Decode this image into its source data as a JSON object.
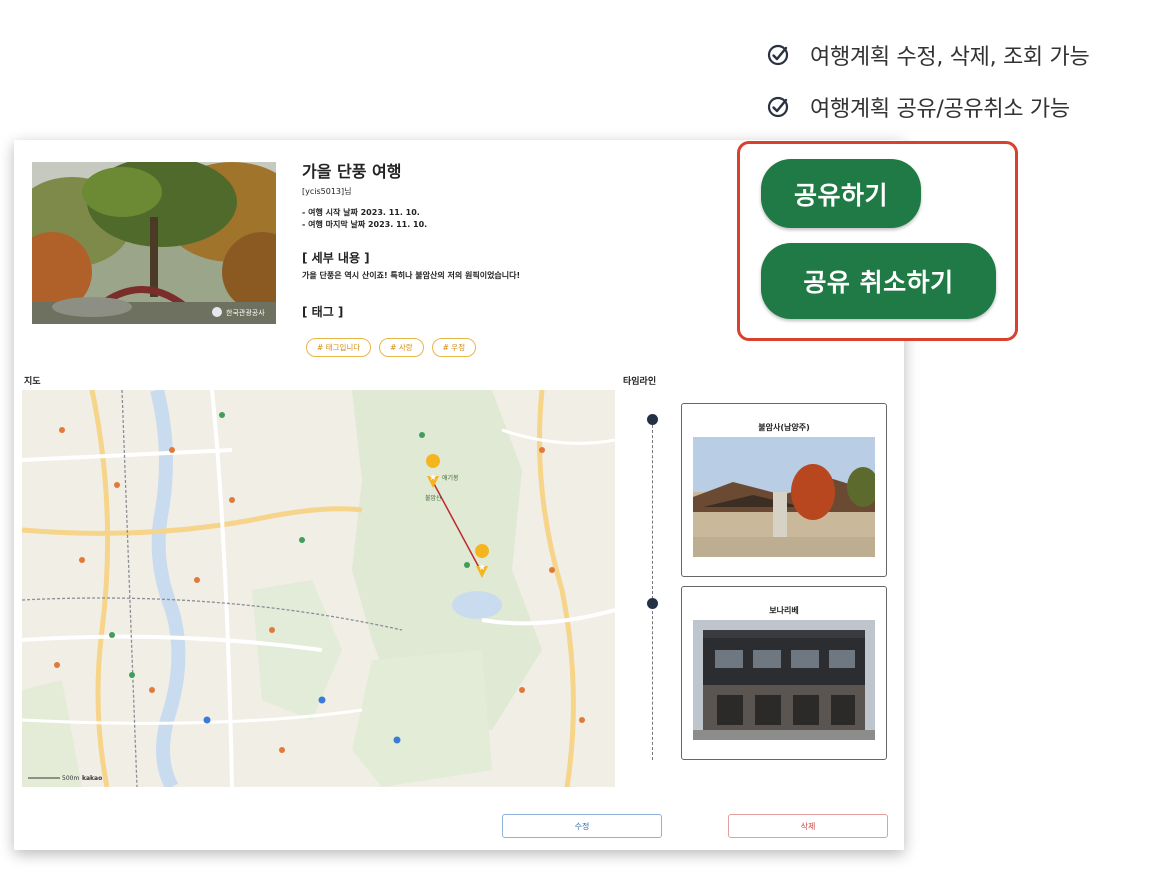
{
  "features": [
    {
      "icon": "check-circle-icon",
      "label": "여행계획 수정, 삭제, 조회 가능"
    },
    {
      "icon": "check-circle-icon",
      "label": "여행계획 공유/공유취소 가능"
    }
  ],
  "plan": {
    "title": "가을 단풍 여행",
    "user": "[ycis5013]님",
    "start_date": "- 여행 시작 날짜 2023. 11. 10.",
    "end_date": "- 여행 마지막 날짜 2023. 11. 10.",
    "detail_heading": "[ 세부 내용 ]",
    "detail_text": "가을 단풍은 역시 산이죠! 특히나 불암산의 저의 원픽이었습니다!",
    "tag_heading": "[ 태그 ]",
    "tags": [
      "# 태그입니다",
      "# 사랑",
      "# 우정"
    ],
    "photo_watermark": "한국관광공사"
  },
  "map": {
    "label": "지도",
    "markers": [
      "애기봉",
      "불암산"
    ],
    "scale_text": "500m",
    "provider": "kakao"
  },
  "timeline": {
    "label": "타임라인",
    "items": [
      {
        "name": "불암사(남양주)"
      },
      {
        "name": "보나리베"
      }
    ]
  },
  "actions": {
    "edit": "수정",
    "delete": "삭제",
    "share": "공유하기",
    "unshare": "공유 취소하기"
  },
  "colors": {
    "share_green": "#1f7a45",
    "highlight_red": "#d9412e",
    "tag_orange": "#e9b64a",
    "route_red": "#c0292d"
  }
}
